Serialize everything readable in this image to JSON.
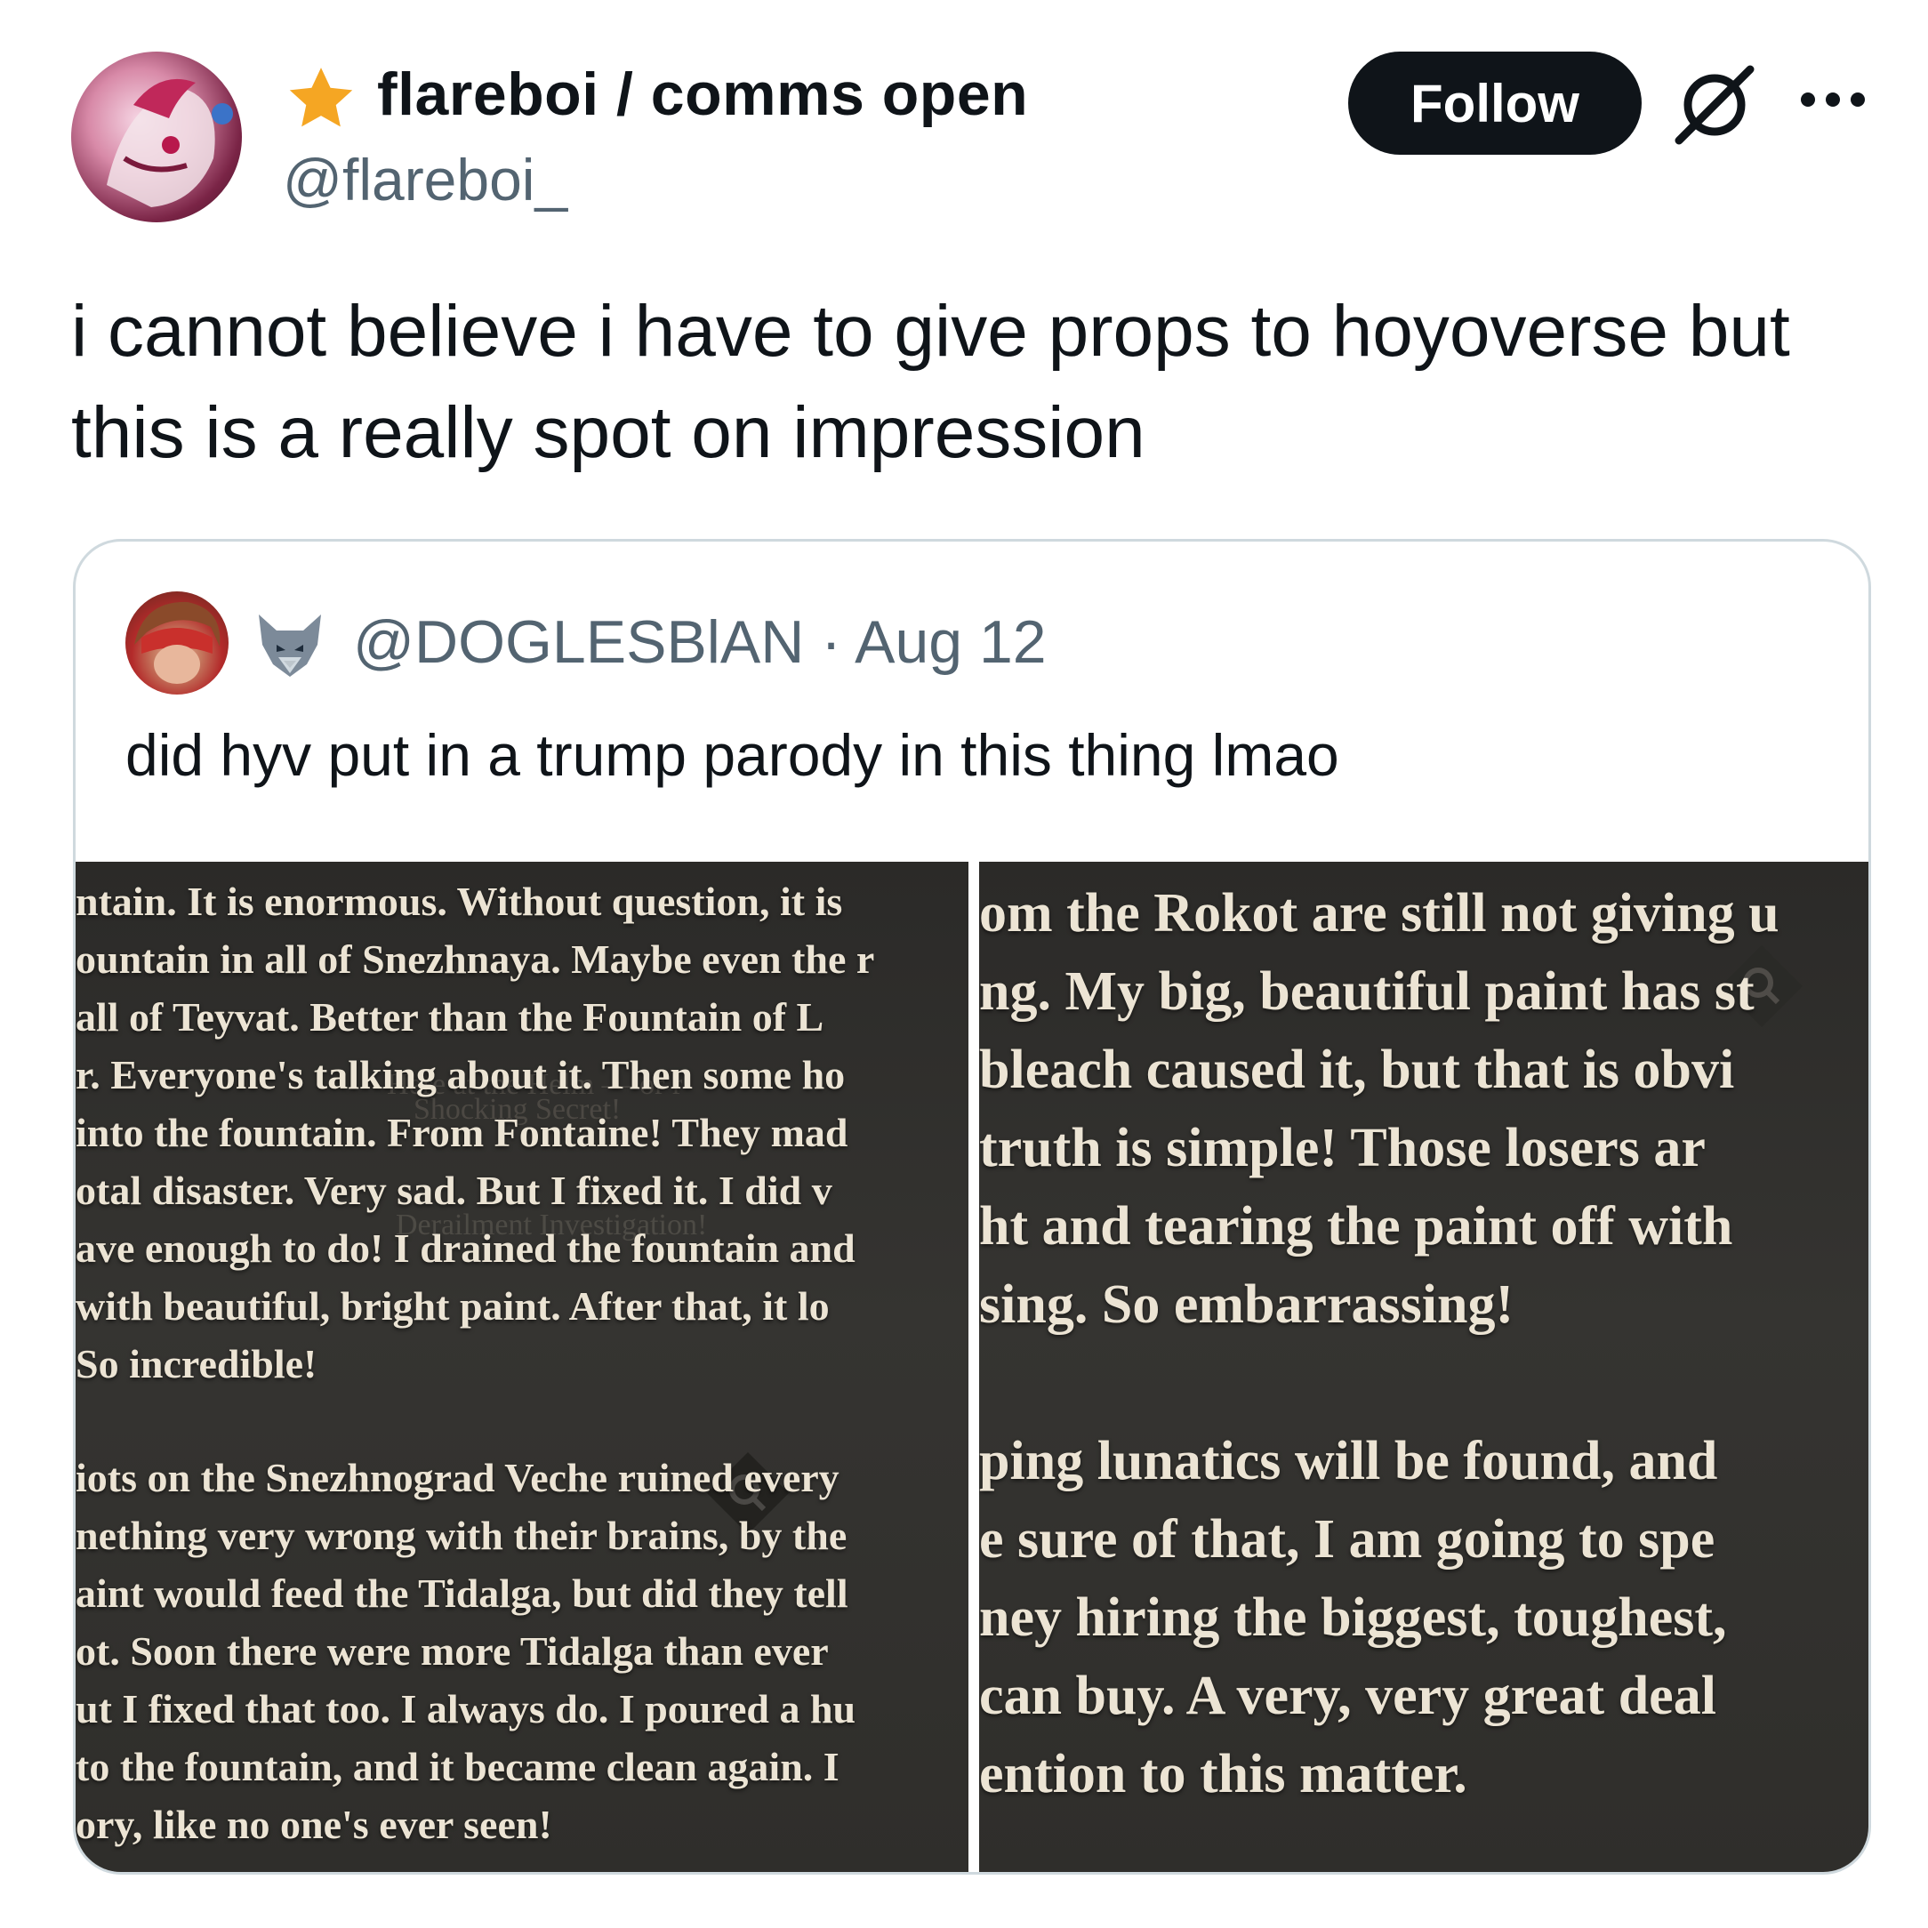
{
  "author": {
    "display_name": "flareboi / comms open",
    "handle": "@flareboi_",
    "avatar": "avatar-illustration",
    "badge_icon": "star-icon"
  },
  "header": {
    "follow_label": "Follow",
    "grok_icon": "grok-icon",
    "more_icon": "more-horizontal-icon"
  },
  "tweet": {
    "text_line1": "i cannot believe i have to give props to hoyoverse but",
    "text_line2": "this is a really spot on impression"
  },
  "quote": {
    "badge_icon": "wolf-icon",
    "handle": "@DOGLESBlAN",
    "separator": "·",
    "date": "Aug 12",
    "text": "did hyv put in a trump parody in this thing lmao",
    "left_screenshot_lines": [
      "ntain. It is enormous. Without question, it is",
      "ountain in all of Snezhnaya. Maybe even the r",
      "all of Teyvat. Better than the Fountain of L",
      "r. Everyone's talking about it. Then some ho",
      "into the fountain. From Fontaine! They mad",
      "otal disaster. Very sad. But I fixed it. I did v",
      "ave enough to do! I drained the fountain and",
      "with beautiful, bright paint. After that, it lo",
      "So incredible!",
      "iots on the Snezhnograd Veche ruined every",
      "nething very wrong with their brains, by the",
      "aint would feed the Tidalga, but did they tell",
      "ot. Soon there were more Tidalga than ever",
      "ut I fixed that too. I always do. I poured a hu",
      "to the fountain, and it became clean again. I",
      "ory, like no one's ever seen!"
    ],
    "right_screenshot_lines": [
      "om the Rokot are still not giving u",
      "ng. My big, beautiful paint has st",
      "bleach caused it, but that is obvi",
      "truth is simple! Those losers ar",
      "ht and tearing the paint off with",
      "sing. So embarrassing!",
      "ping lunatics will be found, and",
      "e sure of that, I am going to spe",
      "ney hiring the biggest, toughest,",
      "can buy. A very, very great deal",
      "ention to this matter."
    ]
  },
  "colors": {
    "text_primary": "#0f1419",
    "text_secondary": "#536471",
    "follow_bg": "#0f1419",
    "card_border": "#cfd9de",
    "star": "#f5a623",
    "game_text": "#ece4d4"
  }
}
